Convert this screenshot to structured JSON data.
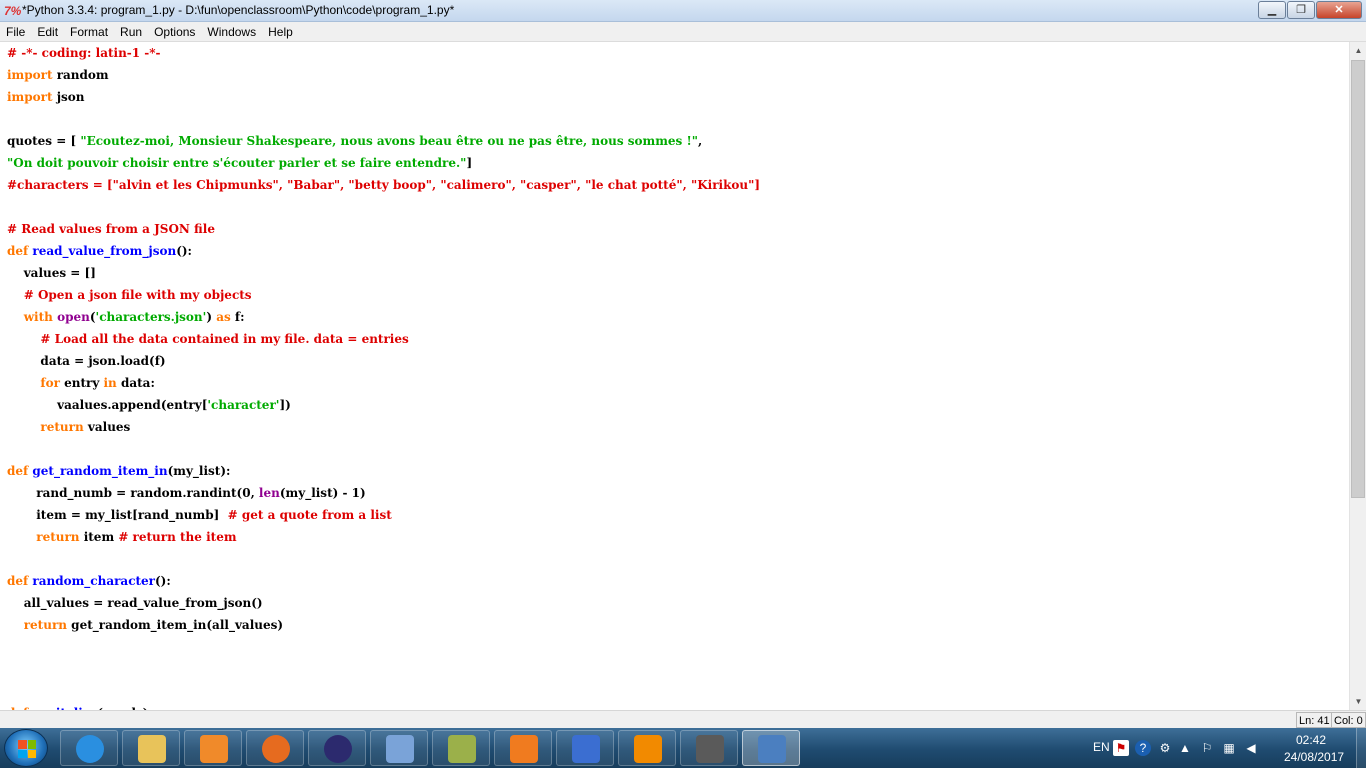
{
  "window": {
    "title": "*Python 3.3.4: program_1.py - D:\\fun\\openclassroom\\Python\\code\\program_1.py*",
    "icon_glyph": "7%",
    "minimize_glyph": "▁",
    "maximize_glyph": "❐",
    "close_glyph": "✕"
  },
  "menu": [
    "File",
    "Edit",
    "Format",
    "Run",
    "Options",
    "Windows",
    "Help"
  ],
  "editor": {
    "lines": [
      [
        {
          "t": "# -*- coding: latin-1 -*-",
          "c": "com"
        }
      ],
      [
        {
          "t": "import",
          "c": "kw"
        },
        {
          "t": " random",
          "c": "tx"
        }
      ],
      [
        {
          "t": "import",
          "c": "kw"
        },
        {
          "t": " json",
          "c": "tx"
        }
      ],
      [],
      [
        {
          "t": "quotes = [ ",
          "c": "tx"
        },
        {
          "t": "\"Ecoutez-moi, Monsieur Shakespeare, nous avons beau être ou ne pas être, nous sommes !\"",
          "c": "str"
        },
        {
          "t": ",",
          "c": "tx"
        }
      ],
      [
        {
          "t": "\"On doit pouvoir choisir entre s'écouter parler et se faire entendre.\"",
          "c": "str"
        },
        {
          "t": "]",
          "c": "tx"
        }
      ],
      [
        {
          "t": "#characters = [\"alvin et les Chipmunks\", \"Babar\", \"betty boop\", \"calimero\", \"casper\", \"le chat potté\", \"Kirikou\"]",
          "c": "com"
        }
      ],
      [],
      [
        {
          "t": "# Read values from a JSON file",
          "c": "com"
        }
      ],
      [
        {
          "t": "def",
          "c": "kw"
        },
        {
          "t": " ",
          "c": "tx"
        },
        {
          "t": "read_value_from_json",
          "c": "def"
        },
        {
          "t": "():",
          "c": "tx"
        }
      ],
      [
        {
          "t": "    values = []",
          "c": "tx"
        }
      ],
      [
        {
          "t": "    ",
          "c": "tx"
        },
        {
          "t": "# Open a json file with my objects",
          "c": "com"
        }
      ],
      [
        {
          "t": "    ",
          "c": "tx"
        },
        {
          "t": "with",
          "c": "kw"
        },
        {
          "t": " ",
          "c": "tx"
        },
        {
          "t": "open",
          "c": "bi"
        },
        {
          "t": "(",
          "c": "tx"
        },
        {
          "t": "'characters.json'",
          "c": "str"
        },
        {
          "t": ") ",
          "c": "tx"
        },
        {
          "t": "as",
          "c": "kw"
        },
        {
          "t": " f:",
          "c": "tx"
        }
      ],
      [
        {
          "t": "        ",
          "c": "tx"
        },
        {
          "t": "# Load all the data contained in my file. data = entries",
          "c": "com"
        }
      ],
      [
        {
          "t": "        data = json.load(f)",
          "c": "tx"
        }
      ],
      [
        {
          "t": "        ",
          "c": "tx"
        },
        {
          "t": "for",
          "c": "kw"
        },
        {
          "t": " entry ",
          "c": "tx"
        },
        {
          "t": "in",
          "c": "kw"
        },
        {
          "t": " data:",
          "c": "tx"
        }
      ],
      [
        {
          "t": "            vaalues.append(entry[",
          "c": "tx"
        },
        {
          "t": "'character'",
          "c": "str"
        },
        {
          "t": "])",
          "c": "tx"
        }
      ],
      [
        {
          "t": "        ",
          "c": "tx"
        },
        {
          "t": "return",
          "c": "kw"
        },
        {
          "t": " values",
          "c": "tx"
        }
      ],
      [],
      [
        {
          "t": "def",
          "c": "kw"
        },
        {
          "t": " ",
          "c": "tx"
        },
        {
          "t": "get_random_item_in",
          "c": "def"
        },
        {
          "t": "(my_list):",
          "c": "tx"
        }
      ],
      [
        {
          "t": "       rand_numb = random.randint(0, ",
          "c": "tx"
        },
        {
          "t": "len",
          "c": "bi"
        },
        {
          "t": "(my_list) - 1)",
          "c": "tx"
        }
      ],
      [
        {
          "t": "       item = my_list[rand_numb]  ",
          "c": "tx"
        },
        {
          "t": "# get a quote from a list",
          "c": "com"
        }
      ],
      [
        {
          "t": "       ",
          "c": "tx"
        },
        {
          "t": "return",
          "c": "kw"
        },
        {
          "t": " item ",
          "c": "tx"
        },
        {
          "t": "# return the item",
          "c": "com"
        }
      ],
      [],
      [
        {
          "t": "def",
          "c": "kw"
        },
        {
          "t": " ",
          "c": "tx"
        },
        {
          "t": "random_character",
          "c": "def"
        },
        {
          "t": "():",
          "c": "tx"
        }
      ],
      [
        {
          "t": "    all_values = read_value_from_json()",
          "c": "tx"
        }
      ],
      [
        {
          "t": "    ",
          "c": "tx"
        },
        {
          "t": "return",
          "c": "kw"
        },
        {
          "t": " get_random_item_in(all_values)",
          "c": "tx"
        }
      ],
      [],
      [],
      [],
      [
        {
          "t": "def",
          "c": "kw"
        },
        {
          "t": " ",
          "c": "tx"
        },
        {
          "t": "capitalize",
          "c": "def"
        },
        {
          "t": "(words):",
          "c": "tx"
        }
      ]
    ]
  },
  "colors": {
    "keyword": "#ff7700",
    "string": "#00aa00",
    "comment": "#dd0000",
    "definition": "#0000ff",
    "builtin": "#900090",
    "text": "#000000"
  },
  "status": {
    "line": "Ln: 41",
    "col": "Col: 0"
  },
  "taskbar": {
    "apps": [
      {
        "name": "internet-explorer",
        "icon": "ie-icon",
        "color": "#2a8fe0"
      },
      {
        "name": "file-explorer",
        "icon": "folder-icon",
        "color": "#e8c35a"
      },
      {
        "name": "media-player",
        "icon": "media-player-icon",
        "color": "#f08a2a"
      },
      {
        "name": "firefox",
        "icon": "firefox-icon",
        "color": "#e66b1f"
      },
      {
        "name": "eclipse",
        "icon": "eclipse-icon",
        "color": "#2c2a6e"
      },
      {
        "name": "remote-desktop",
        "icon": "remote-desktop-icon",
        "color": "#7aa3d8"
      },
      {
        "name": "texmaker",
        "icon": "txc-icon",
        "color": "#9bb04a"
      },
      {
        "name": "pdf-tool",
        "icon": "pdf-icon",
        "color": "#f07b1f"
      },
      {
        "name": "top-chrono",
        "icon": "top-chrono-icon",
        "color": "#3b6ed1"
      },
      {
        "name": "vlc",
        "icon": "vlc-icon",
        "color": "#f28a00"
      },
      {
        "name": "sublime-text",
        "icon": "sublime-icon",
        "color": "#5a5a5a"
      },
      {
        "name": "python-idle",
        "icon": "python-icon",
        "color": "#4b7fc0",
        "active": true
      }
    ],
    "language": "EN",
    "time": "02:42",
    "date": "24/08/2017"
  }
}
